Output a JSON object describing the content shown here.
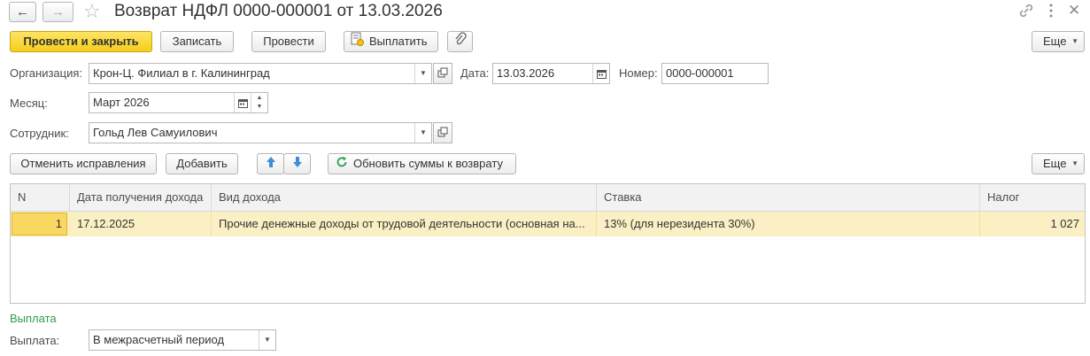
{
  "header": {
    "title": "Возврат НДФЛ 0000-000001 от 13.03.2026",
    "back_icon": "arrow-left-icon",
    "forward_icon": "arrow-right-icon",
    "favorite_icon": "star-icon",
    "link_icon": "link-icon",
    "menu_icon": "vertical-dots-icon",
    "close_icon": "close-icon"
  },
  "toolbar": {
    "post_close_label": "Провести и закрыть",
    "save_label": "Записать",
    "post_label": "Провести",
    "pay_label": "Выплатить",
    "more_label": "Еще"
  },
  "form": {
    "org_label": "Организация:",
    "org_value": "Крон-Ц. Филиал в г. Калининград",
    "date_label": "Дата:",
    "date_value": "13.03.2026",
    "number_label": "Номер:",
    "number_value": "0000-000001",
    "month_label": "Месяц:",
    "month_value": "Март 2026",
    "employee_label": "Сотрудник:",
    "employee_value": "Гольд Лев Самуилович"
  },
  "table_toolbar": {
    "cancel_corrections_label": "Отменить исправления",
    "add_label": "Добавить",
    "refresh_label": "Обновить суммы к возврату",
    "more_label": "Еще"
  },
  "table": {
    "columns": [
      "N",
      "Дата получения дохода",
      "Вид дохода",
      "Ставка",
      "Налог"
    ],
    "rows": [
      {
        "n": "1",
        "date": "17.12.2025",
        "income_type": "Прочие денежные доходы от трудовой деятельности (основная на...",
        "rate": "13% (для нерезидента 30%)",
        "tax": "1 027"
      }
    ]
  },
  "payment": {
    "section_title": "Выплата",
    "label": "Выплата:",
    "value": "В межрасчетный период"
  },
  "colors": {
    "primary_button": "#f4cf1b",
    "selected_row": "#fbf0c4",
    "selected_cell": "#f8d860",
    "section_title": "#2e9c4a",
    "arrow_blue": "#3b8fd9"
  }
}
